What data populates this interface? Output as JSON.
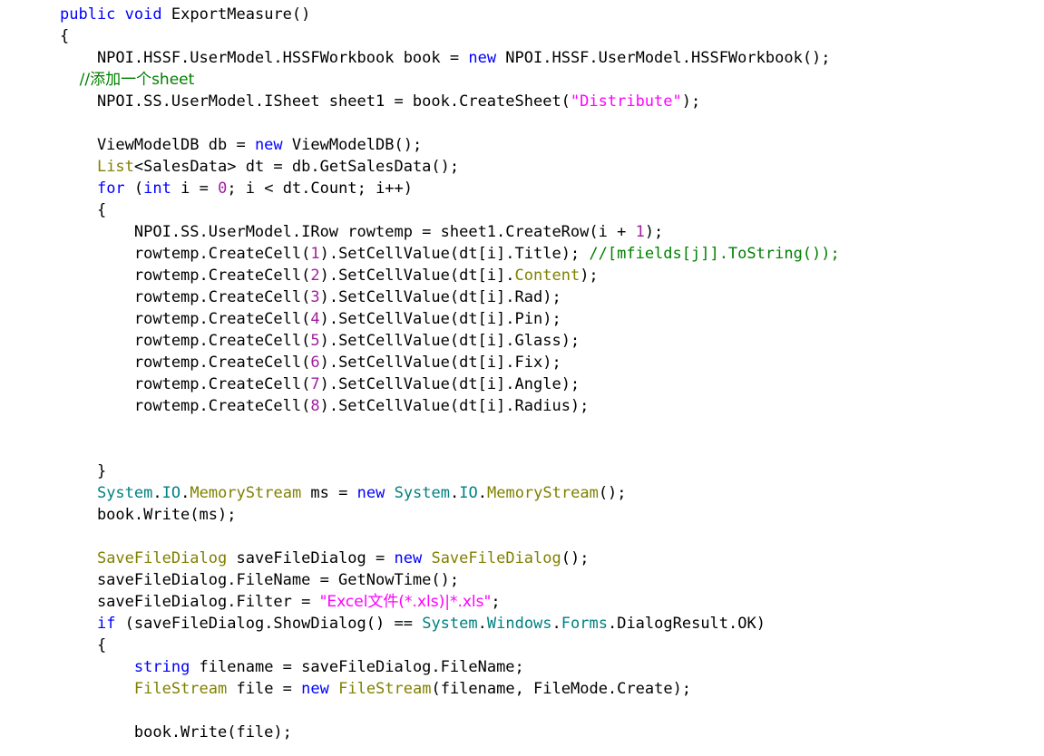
{
  "editor": {
    "language": "csharp",
    "background": "#ffffff",
    "font_size_px": 17,
    "line_height_px": 24,
    "colors": {
      "keyword": "#0000ff",
      "type": "#808000",
      "namespace": "#008080",
      "string": "#ff00ff",
      "number": "#a020a0",
      "comment": "#008000",
      "plain": "#000000"
    }
  },
  "code": {
    "lines": [
      [
        {
          "t": "public",
          "c": "kw"
        },
        {
          "t": " ",
          "c": "pln"
        },
        {
          "t": "void",
          "c": "kw"
        },
        {
          "t": " ExportMeasure()",
          "c": "pln"
        }
      ],
      [
        {
          "t": "{",
          "c": "pln"
        }
      ],
      [
        {
          "t": "    NPOI.HSSF.UserModel.HSSFWorkbook book = ",
          "c": "pln"
        },
        {
          "t": "new",
          "c": "kw"
        },
        {
          "t": " NPOI.HSSF.UserModel.HSSFWorkbook();",
          "c": "pln"
        }
      ],
      [
        {
          "t": "    //添加一个sheet",
          "c": "cmt"
        }
      ],
      [
        {
          "t": "    NPOI.SS.UserModel.ISheet sheet1 = book.CreateSheet(",
          "c": "pln"
        },
        {
          "t": "\"Distribute\"",
          "c": "str"
        },
        {
          "t": ");",
          "c": "pln"
        }
      ],
      [
        {
          "t": "",
          "c": "pln"
        }
      ],
      [
        {
          "t": "    ViewModelDB db = ",
          "c": "pln"
        },
        {
          "t": "new",
          "c": "kw"
        },
        {
          "t": " ViewModelDB();",
          "c": "pln"
        }
      ],
      [
        {
          "t": "    ",
          "c": "pln"
        },
        {
          "t": "List",
          "c": "type"
        },
        {
          "t": "<SalesData> dt = db.GetSalesData();",
          "c": "pln"
        }
      ],
      [
        {
          "t": "    ",
          "c": "pln"
        },
        {
          "t": "for",
          "c": "kw"
        },
        {
          "t": " (",
          "c": "pln"
        },
        {
          "t": "int",
          "c": "kw"
        },
        {
          "t": " i = ",
          "c": "pln"
        },
        {
          "t": "0",
          "c": "num"
        },
        {
          "t": "; i < dt.Count; i++)",
          "c": "pln"
        }
      ],
      [
        {
          "t": "    {",
          "c": "pln"
        }
      ],
      [
        {
          "t": "        NPOI.SS.UserModel.IRow rowtemp = sheet1.CreateRow(i + ",
          "c": "pln"
        },
        {
          "t": "1",
          "c": "num"
        },
        {
          "t": ");",
          "c": "pln"
        }
      ],
      [
        {
          "t": "        rowtemp.CreateCell(",
          "c": "pln"
        },
        {
          "t": "1",
          "c": "num"
        },
        {
          "t": ").SetCellValue(dt[i].Title); ",
          "c": "pln"
        },
        {
          "t": "//[mfields[j]].ToString());",
          "c": "cmt"
        }
      ],
      [
        {
          "t": "        rowtemp.CreateCell(",
          "c": "pln"
        },
        {
          "t": "2",
          "c": "num"
        },
        {
          "t": ").SetCellValue(dt[i].",
          "c": "pln"
        },
        {
          "t": "Content",
          "c": "type"
        },
        {
          "t": ");",
          "c": "pln"
        }
      ],
      [
        {
          "t": "        rowtemp.CreateCell(",
          "c": "pln"
        },
        {
          "t": "3",
          "c": "num"
        },
        {
          "t": ").SetCellValue(dt[i].Rad);",
          "c": "pln"
        }
      ],
      [
        {
          "t": "        rowtemp.CreateCell(",
          "c": "pln"
        },
        {
          "t": "4",
          "c": "num"
        },
        {
          "t": ").SetCellValue(dt[i].Pin);",
          "c": "pln"
        }
      ],
      [
        {
          "t": "        rowtemp.CreateCell(",
          "c": "pln"
        },
        {
          "t": "5",
          "c": "num"
        },
        {
          "t": ").SetCellValue(dt[i].Glass);",
          "c": "pln"
        }
      ],
      [
        {
          "t": "        rowtemp.CreateCell(",
          "c": "pln"
        },
        {
          "t": "6",
          "c": "num"
        },
        {
          "t": ").SetCellValue(dt[i].Fix);",
          "c": "pln"
        }
      ],
      [
        {
          "t": "        rowtemp.CreateCell(",
          "c": "pln"
        },
        {
          "t": "7",
          "c": "num"
        },
        {
          "t": ").SetCellValue(dt[i].Angle);",
          "c": "pln"
        }
      ],
      [
        {
          "t": "        rowtemp.CreateCell(",
          "c": "pln"
        },
        {
          "t": "8",
          "c": "num"
        },
        {
          "t": ").SetCellValue(dt[i].Radius);",
          "c": "pln"
        }
      ],
      [
        {
          "t": "",
          "c": "pln"
        }
      ],
      [
        {
          "t": "",
          "c": "pln"
        }
      ],
      [
        {
          "t": "    }",
          "c": "pln"
        }
      ],
      [
        {
          "t": "    ",
          "c": "pln"
        },
        {
          "t": "System",
          "c": "ns"
        },
        {
          "t": ".",
          "c": "pln"
        },
        {
          "t": "IO",
          "c": "ns"
        },
        {
          "t": ".",
          "c": "pln"
        },
        {
          "t": "MemoryStream",
          "c": "type"
        },
        {
          "t": " ms = ",
          "c": "pln"
        },
        {
          "t": "new",
          "c": "kw"
        },
        {
          "t": " ",
          "c": "pln"
        },
        {
          "t": "System",
          "c": "ns"
        },
        {
          "t": ".",
          "c": "pln"
        },
        {
          "t": "IO",
          "c": "ns"
        },
        {
          "t": ".",
          "c": "pln"
        },
        {
          "t": "MemoryStream",
          "c": "type"
        },
        {
          "t": "();",
          "c": "pln"
        }
      ],
      [
        {
          "t": "    book.Write(ms);",
          "c": "pln"
        }
      ],
      [
        {
          "t": "",
          "c": "pln"
        }
      ],
      [
        {
          "t": "    ",
          "c": "pln"
        },
        {
          "t": "SaveFileDialog",
          "c": "type"
        },
        {
          "t": " saveFileDialog = ",
          "c": "pln"
        },
        {
          "t": "new",
          "c": "kw"
        },
        {
          "t": " ",
          "c": "pln"
        },
        {
          "t": "SaveFileDialog",
          "c": "type"
        },
        {
          "t": "();",
          "c": "pln"
        }
      ],
      [
        {
          "t": "    saveFileDialog.FileName = GetNowTime();",
          "c": "pln"
        }
      ],
      [
        {
          "t": "    saveFileDialog.Filter = ",
          "c": "pln"
        },
        {
          "t": "\"Excel文件(*.xls)|*.xls\"",
          "c": "str"
        },
        {
          "t": ";",
          "c": "pln"
        }
      ],
      [
        {
          "t": "    ",
          "c": "pln"
        },
        {
          "t": "if",
          "c": "kw"
        },
        {
          "t": " (saveFileDialog.ShowDialog() == ",
          "c": "pln"
        },
        {
          "t": "System",
          "c": "ns"
        },
        {
          "t": ".",
          "c": "pln"
        },
        {
          "t": "Windows",
          "c": "ns"
        },
        {
          "t": ".",
          "c": "pln"
        },
        {
          "t": "Forms",
          "c": "ns"
        },
        {
          "t": ".DialogResult.OK)",
          "c": "pln"
        }
      ],
      [
        {
          "t": "    {",
          "c": "pln"
        }
      ],
      [
        {
          "t": "        ",
          "c": "pln"
        },
        {
          "t": "string",
          "c": "kw"
        },
        {
          "t": " filename = saveFileDialog.FileName;",
          "c": "pln"
        }
      ],
      [
        {
          "t": "        ",
          "c": "pln"
        },
        {
          "t": "FileStream",
          "c": "type"
        },
        {
          "t": " file = ",
          "c": "pln"
        },
        {
          "t": "new",
          "c": "kw"
        },
        {
          "t": " ",
          "c": "pln"
        },
        {
          "t": "FileStream",
          "c": "type"
        },
        {
          "t": "(filename, FileMode.Create);",
          "c": "pln"
        }
      ],
      [
        {
          "t": "",
          "c": "pln"
        }
      ],
      [
        {
          "t": "        book.Write(file);",
          "c": "pln"
        }
      ]
    ]
  }
}
